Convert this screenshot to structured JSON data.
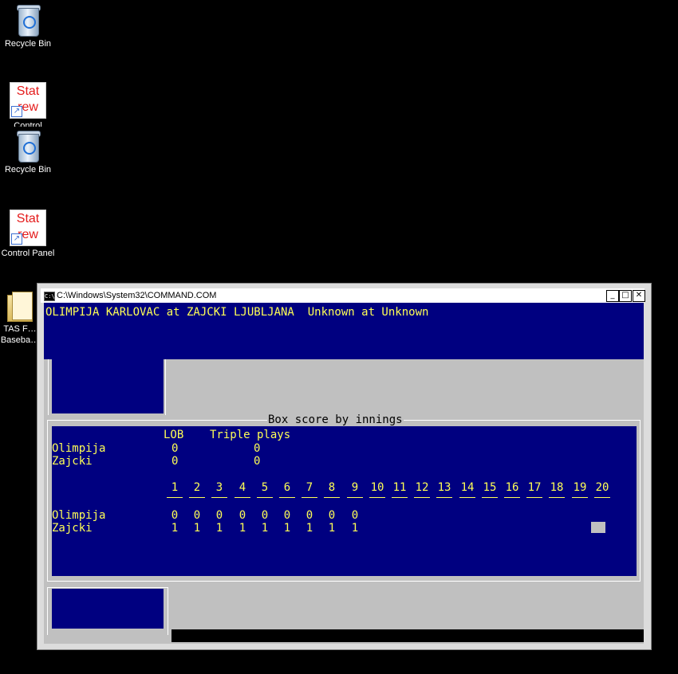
{
  "desktop": {
    "icons": [
      {
        "label": "Recycle Bin"
      },
      {
        "label": "Control"
      },
      {
        "label": "Recycle Bin"
      },
      {
        "label": "Control Panel"
      },
      {
        "label": "TAS F… Baseba…"
      }
    ],
    "stat_top": "Stat",
    "stat_bottom": "rew"
  },
  "window": {
    "title": "C:\\Windows\\System32\\COMMAND.COM",
    "minimize": "_",
    "maximize": "□",
    "close": "✕"
  },
  "console": {
    "header_line": "OLIMPIJA KARLOVAC at ZAJCKI LJUBLJANA  Unknown at Unknown",
    "panel_title": "Box score by innings",
    "lob_header": "LOB",
    "triple_plays_header": "Triple plays",
    "teams": [
      {
        "name": "Olimpija",
        "lob": "0",
        "triple_plays": "0",
        "innings": [
          "0",
          "0",
          "0",
          "0",
          "0",
          "0",
          "0",
          "0",
          "0"
        ]
      },
      {
        "name": "Zajcki",
        "lob": "0",
        "triple_plays": "0",
        "innings": [
          "1",
          "1",
          "1",
          "1",
          "1",
          "1",
          "1",
          "1",
          "1"
        ]
      }
    ],
    "inning_numbers": [
      "1",
      "2",
      "3",
      "4",
      "5",
      "6",
      "7",
      "8",
      "9",
      "10",
      "11",
      "12",
      "13",
      "14",
      "15",
      "16",
      "17",
      "18",
      "19",
      "20"
    ]
  },
  "colors": {
    "console_blue": "#000080",
    "console_yellow": "#ffff55",
    "console_gray": "#c0c0c0"
  }
}
